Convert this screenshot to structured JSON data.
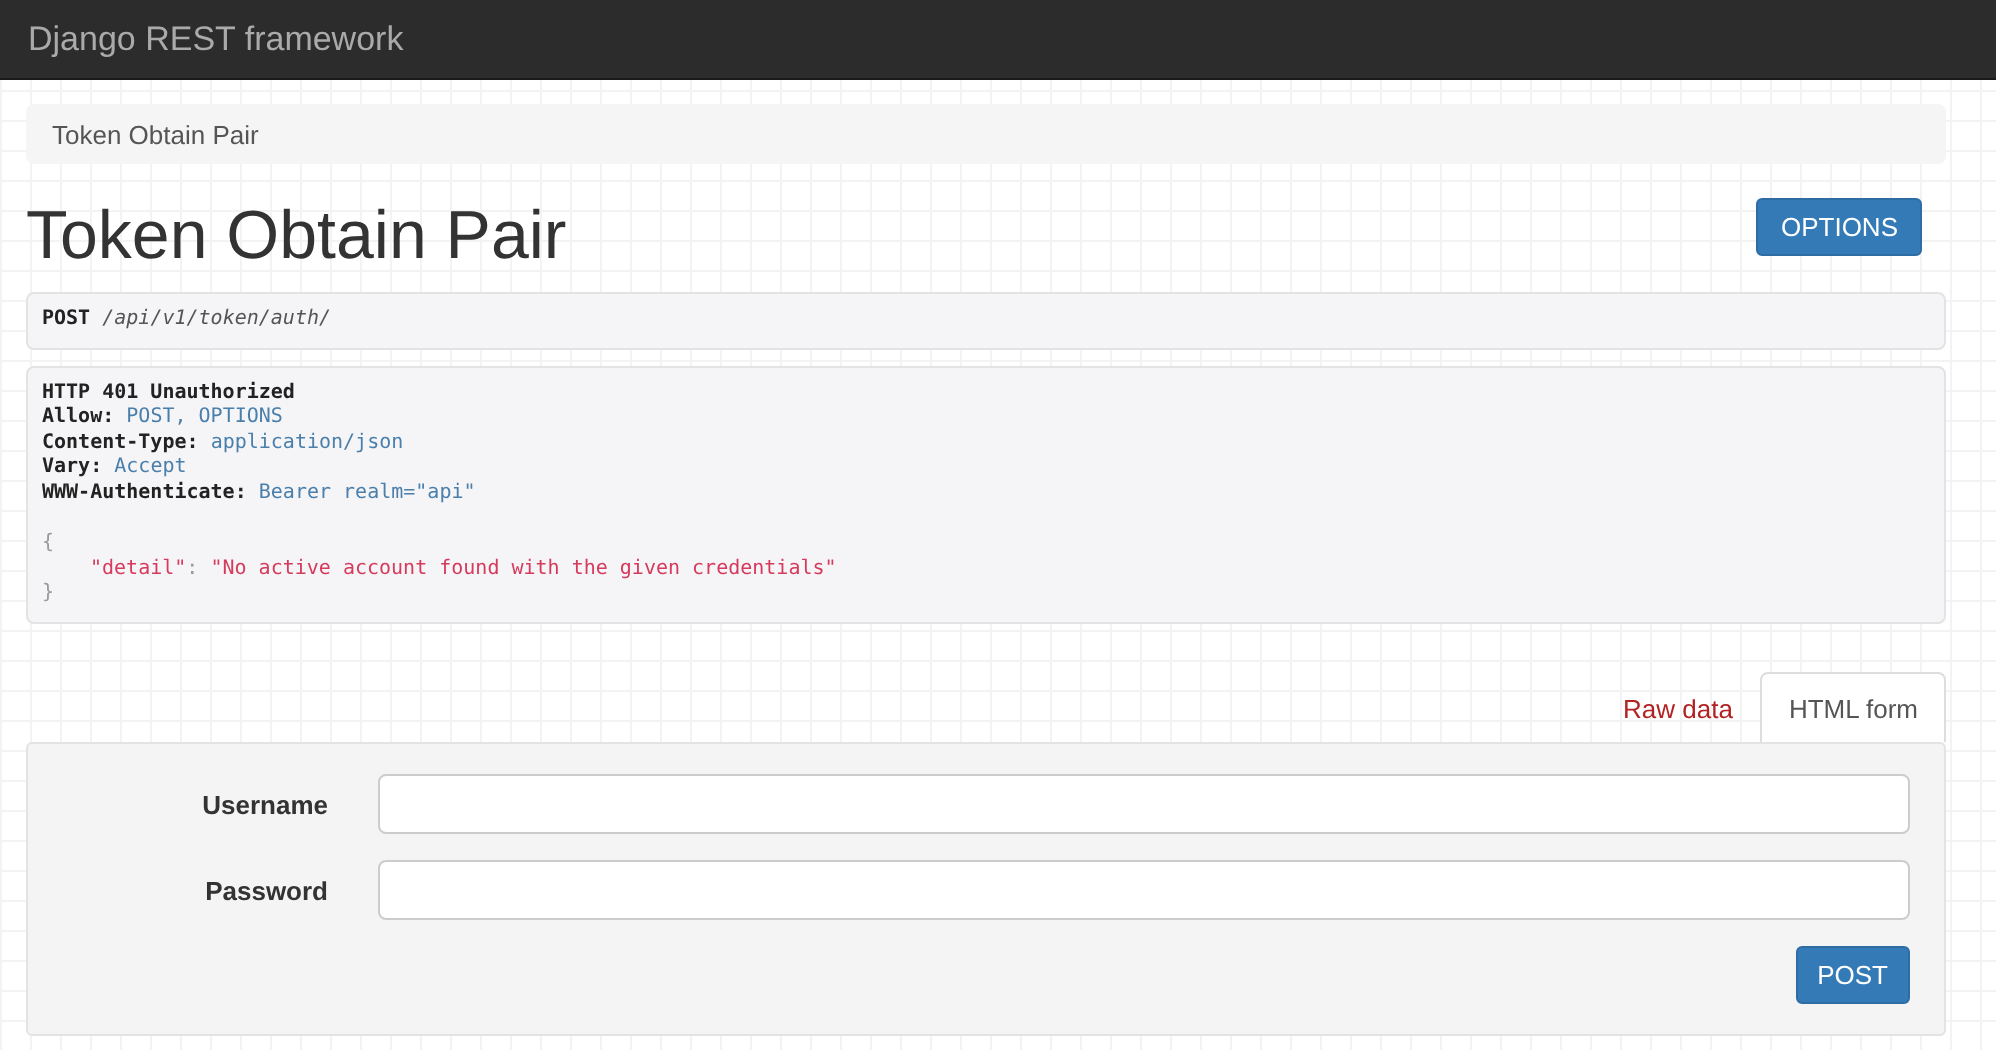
{
  "navbar": {
    "brand": "Django REST framework"
  },
  "breadcrumb": {
    "items": [
      {
        "label": "Token Obtain Pair",
        "selected": true
      }
    ]
  },
  "page_title": "Token Obtain Pair",
  "options_button": "OPTIONS",
  "request": {
    "method": "POST",
    "path": "/api/v1/token/auth/"
  },
  "response": {
    "status": "HTTP 401 Unauthorized",
    "headers": [
      {
        "name": "Allow:",
        "value": "POST, OPTIONS"
      },
      {
        "name": "Content-Type:",
        "value": "application/json"
      },
      {
        "name": "Vary:",
        "value": "Accept"
      },
      {
        "name": "WWW-Authenticate:",
        "value": "Bearer realm=\"api\""
      }
    ],
    "body": [
      {
        "kind": "punct",
        "text": "{"
      },
      {
        "kind": "pair",
        "key": "\"detail\"",
        "sep": ": ",
        "value": "\"No active account found with the given credentials\""
      },
      {
        "kind": "punct",
        "text": "}"
      }
    ]
  },
  "tabs": [
    {
      "label": "Raw data",
      "selected": false
    },
    {
      "label": "HTML form",
      "selected": true
    }
  ],
  "form": {
    "fields": [
      {
        "label": "Username"
      },
      {
        "label": "Password"
      }
    ],
    "submit": "POST"
  }
}
